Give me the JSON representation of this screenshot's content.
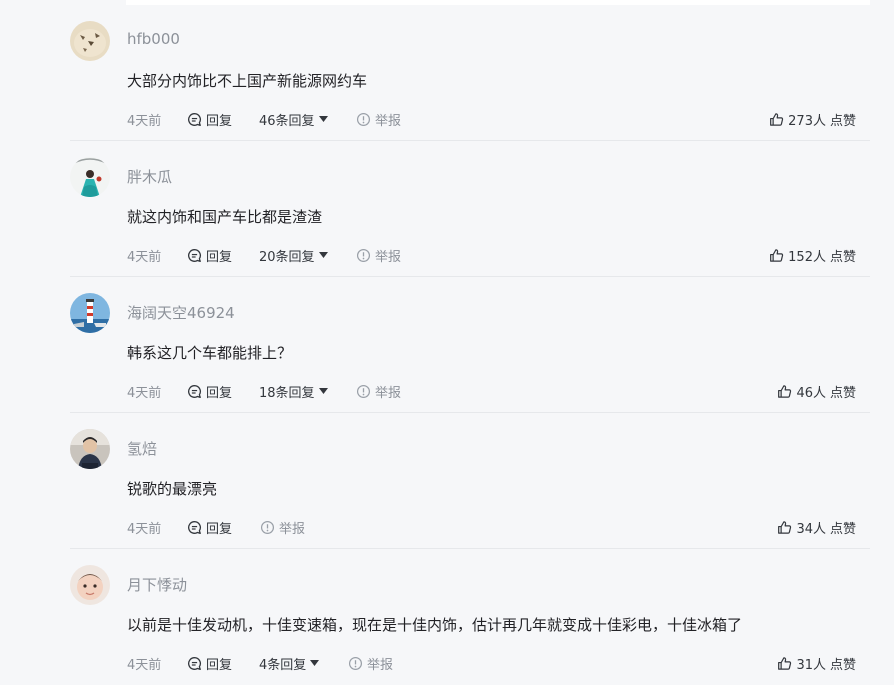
{
  "labels": {
    "reply": "回复",
    "report": "举报",
    "like_suffix": "点赞"
  },
  "comments": [
    {
      "username": "hfb000",
      "content": "大部分内饰比不上国产新能源网约车",
      "time": "4天前",
      "replies": "46条回复",
      "likes": "273人"
    },
    {
      "username": "胖木瓜",
      "content": "就这内饰和国产车比都是渣渣",
      "time": "4天前",
      "replies": "20条回复",
      "likes": "152人"
    },
    {
      "username": "海阔天空46924",
      "content": "韩系这几个车都能排上？",
      "time": "4天前",
      "replies": "18条回复",
      "likes": "46人"
    },
    {
      "username": "氢焙",
      "content": "锐歌的最漂亮",
      "time": "4天前",
      "replies": "",
      "likes": "34人"
    },
    {
      "username": "月下悸动",
      "content": "以前是十佳发动机，十佳变速箱，现在是十佳内饰，估计再几年就变成十佳彩电，十佳冰箱了",
      "time": "4天前",
      "replies": "4条回复",
      "likes": "31人"
    }
  ]
}
